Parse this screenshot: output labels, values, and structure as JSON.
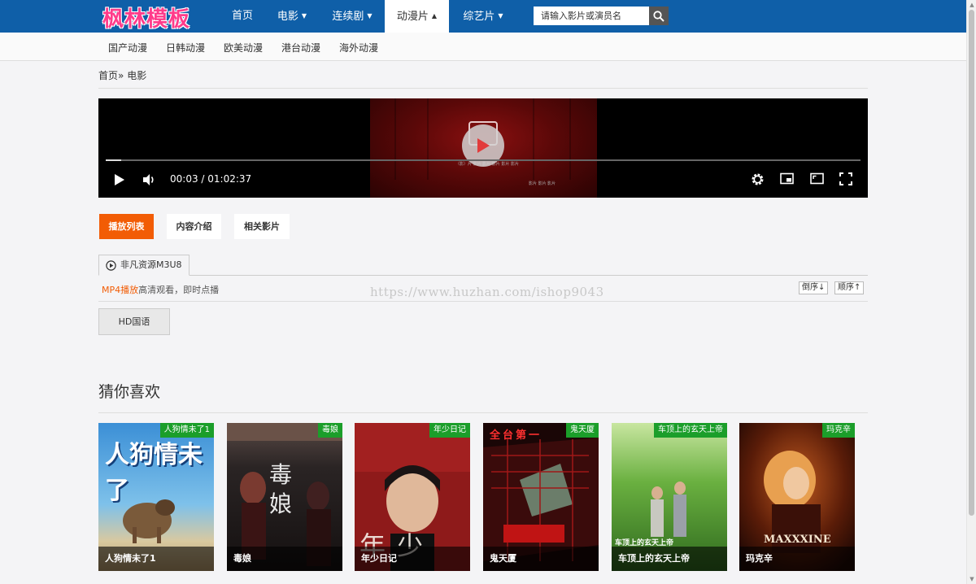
{
  "header": {
    "logo": "枫林模板",
    "nav": [
      {
        "label": "首页",
        "caret": false
      },
      {
        "label": "电影",
        "caret": true
      },
      {
        "label": "连续剧",
        "caret": true
      },
      {
        "label": "动漫片",
        "caret": true,
        "active": true
      },
      {
        "label": "综艺片",
        "caret": true
      }
    ],
    "search": {
      "placeholder": "请输入影片或演员名"
    }
  },
  "subnav": [
    "国产动漫",
    "日韩动漫",
    "欧美动漫",
    "港台动漫",
    "海外动漫"
  ],
  "breadcrumb": {
    "home": "首页",
    "separator": "»",
    "current": "电影"
  },
  "player": {
    "current_time": "00:03",
    "duration": "01:02:37",
    "time_display": "00:03 / 01:02:37",
    "progress": 0.02
  },
  "tabs": [
    "播放列表",
    "内容介绍",
    "相关影片"
  ],
  "source": {
    "name": "非凡资源M3U8",
    "mp4_label": "MP4播放",
    "mp4_desc": "高清观看，即时点播",
    "sort_desc": "倒序↓",
    "sort_asc": "顺序↑"
  },
  "episodes": [
    "HD国语"
  ],
  "watermark": "https://www.huzhan.com/ishop9043",
  "recommend": {
    "title": "猜你喜欢",
    "items": [
      {
        "title": "人狗情未了1",
        "badge": "人狗情未了1",
        "poster_text": "人狗情未了"
      },
      {
        "title": "毒娘",
        "badge": "毒娘",
        "poster_text": "毒娘"
      },
      {
        "title": "年少日记",
        "badge": "年少日记",
        "poster_text": "年少日记"
      },
      {
        "title": "鬼天厦",
        "badge": "鬼天厦",
        "poster_text": "全台第一"
      },
      {
        "title": "车顶上的玄天上帝",
        "badge": "车顶上的玄天上帝",
        "poster_text": "车顶上的玄天上帝"
      },
      {
        "title": "玛克辛",
        "badge": "玛克辛",
        "poster_text": "MAXXXINE"
      }
    ]
  },
  "colors": {
    "nav_bg": "#0f5fa8",
    "accent": "#f25c05",
    "badge": "#1b9e2a",
    "logo": "#ff3b8a"
  }
}
